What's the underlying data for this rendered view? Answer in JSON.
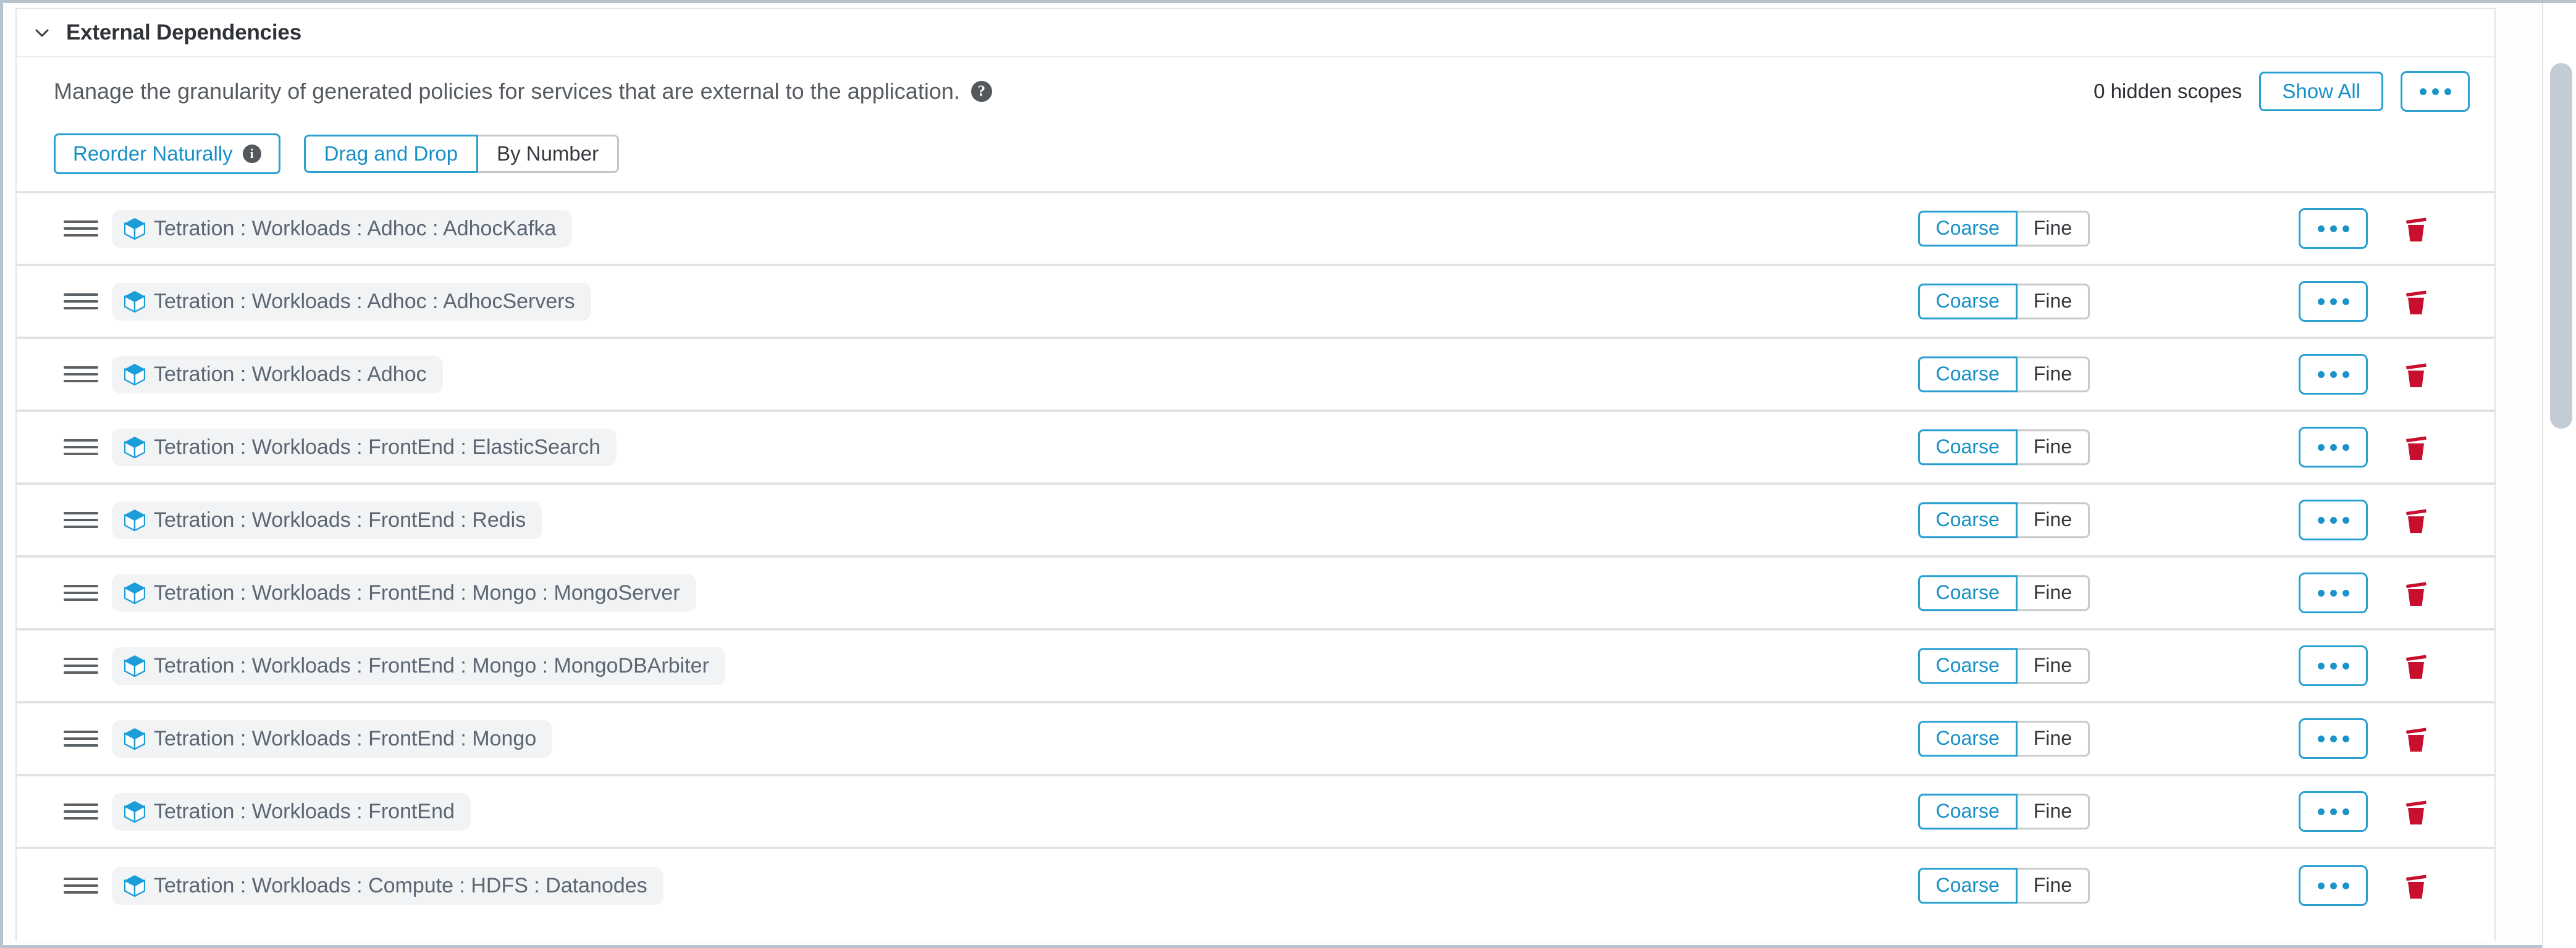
{
  "panel": {
    "title": "External Dependencies",
    "collapse_icon": "chevron-down-icon",
    "description": "Manage the granularity of generated policies for services that are external to the application.",
    "help_icon": "?",
    "hidden_scopes_label": "0 hidden scopes",
    "show_all_label": "Show All",
    "overflow_label": "…"
  },
  "toolbar": {
    "reorder_label": "Reorder Naturally",
    "reorder_info_icon": "i",
    "order_modes": [
      {
        "label": "Drag and Drop",
        "selected": true
      },
      {
        "label": "By Number",
        "selected": false
      }
    ]
  },
  "granularity_options": [
    "Coarse",
    "Fine"
  ],
  "rows": [
    {
      "scope": "Tetration : Workloads : Adhoc : AdhocKafka",
      "granularity": "Coarse"
    },
    {
      "scope": "Tetration : Workloads : Adhoc : AdhocServers",
      "granularity": "Coarse"
    },
    {
      "scope": "Tetration : Workloads : Adhoc",
      "granularity": "Coarse"
    },
    {
      "scope": "Tetration : Workloads : FrontEnd : ElasticSearch",
      "granularity": "Coarse"
    },
    {
      "scope": "Tetration : Workloads : FrontEnd : Redis",
      "granularity": "Coarse"
    },
    {
      "scope": "Tetration : Workloads : FrontEnd : Mongo : MongoServer",
      "granularity": "Coarse"
    },
    {
      "scope": "Tetration : Workloads : FrontEnd : Mongo : MongoDBArbiter",
      "granularity": "Coarse"
    },
    {
      "scope": "Tetration : Workloads : FrontEnd : Mongo",
      "granularity": "Coarse"
    },
    {
      "scope": "Tetration : Workloads : FrontEnd",
      "granularity": "Coarse"
    },
    {
      "scope": "Tetration : Workloads : Compute : HDFS : Datanodes",
      "granularity": "Coarse"
    }
  ],
  "colors": {
    "accent_blue": "#1890c6",
    "border_blue": "#29a0d0",
    "scope_text": "#5a6673",
    "cube_icon": "#1b9dd9",
    "trash_red": "#c8102e",
    "pill_bg": "#f2f3f4",
    "row_divider": "#e0e2e4"
  },
  "icons": {
    "drag_handle": "drag-handle-icon",
    "cube": "scope-cube-icon",
    "trash": "trash-icon",
    "dots": "ellipsis-icon"
  }
}
